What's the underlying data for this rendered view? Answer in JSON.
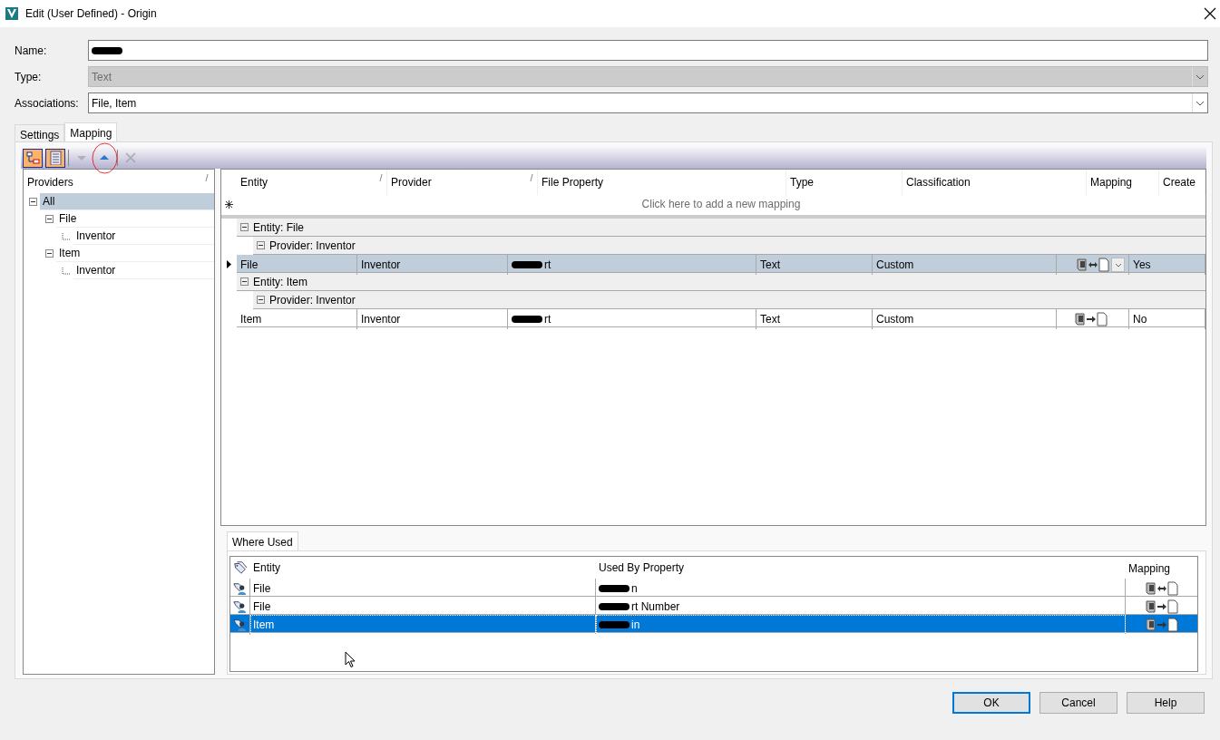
{
  "window": {
    "title": "Edit (User Defined) - Origin"
  },
  "form": [
    {
      "kind": "text",
      "label": "Name:",
      "redacted": true,
      "disabled": false
    },
    {
      "kind": "combo",
      "label": "Type:",
      "value": "Text",
      "disabled": true
    },
    {
      "kind": "combo",
      "label": "Associations:",
      "value": "File, Item",
      "disabled": false
    }
  ],
  "tabs": [
    {
      "label": "Settings",
      "selected": false
    },
    {
      "label": "Mapping",
      "selected": true
    }
  ],
  "toolbar": [
    {
      "kind": "tree",
      "pressed": true,
      "disabled": false,
      "highlighted": false
    },
    {
      "kind": "list",
      "pressed": true,
      "disabled": false,
      "highlighted": false
    },
    {
      "kind": "down",
      "pressed": false,
      "disabled": true,
      "highlighted": false
    },
    {
      "kind": "up",
      "pressed": false,
      "disabled": false,
      "highlighted": true
    },
    {
      "kind": "delete",
      "pressed": false,
      "disabled": true,
      "highlighted": false
    }
  ],
  "providers": {
    "header": "Providers",
    "tree": [
      {
        "label": "All",
        "selected": true,
        "expanded": true,
        "children": [
          {
            "label": "File",
            "selected": false,
            "expanded": true,
            "children": [
              {
                "label": "Inventor",
                "selected": false
              }
            ]
          },
          {
            "label": "Item",
            "selected": false,
            "expanded": true,
            "children": [
              {
                "label": "Inventor",
                "selected": false
              }
            ]
          }
        ]
      }
    ]
  },
  "mapping_grid": {
    "columns": [
      {
        "label": "Entity",
        "sort_mark": true
      },
      {
        "label": "Provider",
        "sort_mark": true
      },
      {
        "label": "File Property",
        "sort_mark": false
      },
      {
        "label": "Type",
        "sort_mark": false
      },
      {
        "label": "Classification",
        "sort_mark": false
      },
      {
        "label": "Mapping",
        "sort_mark": false
      },
      {
        "label": "Create",
        "sort_mark": false
      }
    ],
    "new_row_hint": "Click here to add a new mapping",
    "groups": [
      {
        "label": "Entity: File",
        "expanded": true,
        "providers": [
          {
            "label": "Provider: Inventor",
            "expanded": true,
            "rows": [
              {
                "selected": true,
                "entity": "File",
                "provider": "Inventor",
                "property": "rt",
                "property_redacted": true,
                "type": "Text",
                "classification": "Custom",
                "mapping": {
                  "kind": "both"
                },
                "dropdown": true,
                "create": "Yes"
              }
            ]
          }
        ]
      },
      {
        "label": "Entity: Item",
        "expanded": true,
        "providers": [
          {
            "label": "Provider: Inventor",
            "expanded": true,
            "rows": [
              {
                "selected": false,
                "entity": "Item",
                "provider": "Inventor",
                "property": "rt",
                "property_redacted": true,
                "type": "Text",
                "classification": "Custom",
                "mapping": {
                  "kind": "to_file"
                },
                "dropdown": false,
                "create": "No"
              }
            ]
          }
        ]
      }
    ]
  },
  "where_used": {
    "tab": "Where Used",
    "columns": [
      "Entity",
      "Used By Property",
      "Mapping"
    ],
    "rows": [
      {
        "entity": "File",
        "property": "n",
        "property_redacted": true,
        "mapping": {
          "kind": "both"
        },
        "selected": false
      },
      {
        "entity": "File",
        "property": "rt Number",
        "property_redacted": true,
        "mapping": {
          "kind": "to_file"
        },
        "selected": false
      },
      {
        "entity": "Item",
        "property": "in",
        "property_redacted": true,
        "mapping": {
          "kind": "to_file"
        },
        "selected": true
      }
    ]
  },
  "buttons": [
    {
      "label": "OK",
      "default": true
    },
    {
      "label": "Cancel",
      "default": false
    },
    {
      "label": "Help",
      "default": false
    }
  ]
}
